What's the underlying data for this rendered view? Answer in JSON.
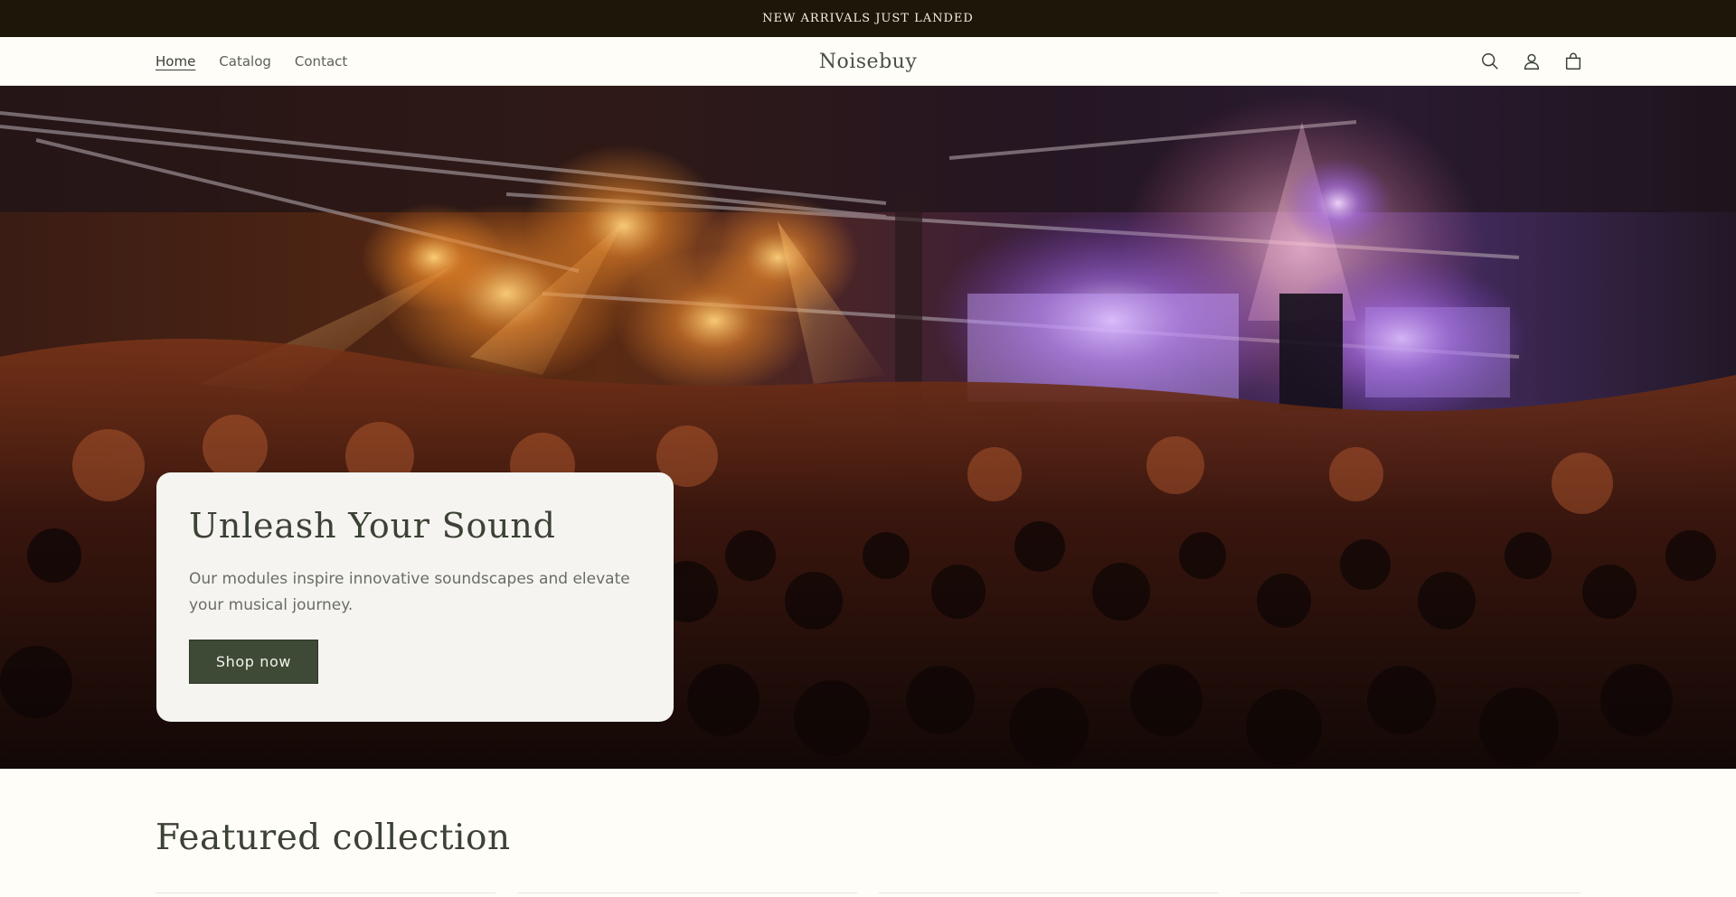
{
  "announcement": {
    "text": "NEW ARRIVALS JUST LANDED"
  },
  "header": {
    "nav": [
      {
        "label": "Home"
      },
      {
        "label": "Catalog"
      },
      {
        "label": "Contact"
      }
    ],
    "logo": "Noisebuy",
    "icons": [
      "search-icon",
      "account-icon",
      "cart-icon"
    ]
  },
  "hero": {
    "title": "Unleash Your Sound",
    "text": "Our modules inspire innovative soundscapes and elevate your musical journey.",
    "button_label": "Shop now"
  },
  "featured": {
    "heading": "Featured collection"
  },
  "colors": {
    "announcement_bg": "#1d1609",
    "page_bg": "#fefdf7",
    "button_bg": "#3e4a35",
    "card_bg": "#f5f4f0"
  }
}
